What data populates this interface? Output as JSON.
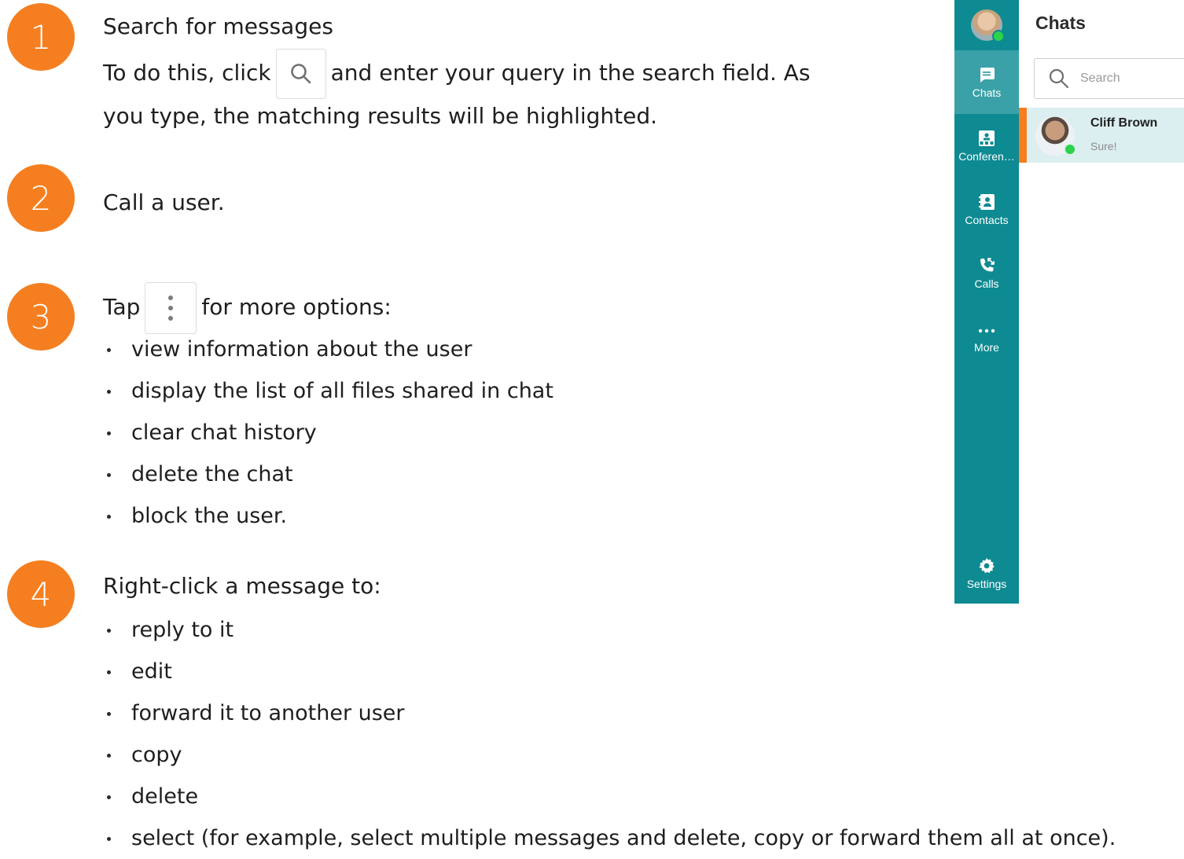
{
  "steps": [
    {
      "number": "1",
      "title": "Search for messages",
      "line2_before": "To do this, click",
      "line2_after": "and enter your query in the search field. As",
      "line3": "you type, the matching results will be highlighted.",
      "inline_icon": "search-icon"
    },
    {
      "number": "2",
      "title": "Call a user."
    },
    {
      "number": "3",
      "title_before": "Tap",
      "title_after": "for more options:",
      "inline_icon": "more-vertical-icon",
      "bullets": [
        "view information about the user",
        "display the list of all files shared in chat",
        "clear chat history",
        "delete the chat",
        "block the user."
      ]
    },
    {
      "number": "4",
      "title": "Right-click a message to:",
      "bullets": [
        "reply to it",
        "edit",
        "forward it to another user",
        "copy",
        "delete",
        "select (for example, select multiple messages and delete, copy or forward them all at once)."
      ]
    }
  ],
  "app": {
    "nav": [
      {
        "label": "Chats",
        "icon": "chat-icon",
        "active": true
      },
      {
        "label": "Conferen…",
        "icon": "conference-icon",
        "active": false
      },
      {
        "label": "Contacts",
        "icon": "contacts-icon",
        "active": false
      },
      {
        "label": "Calls",
        "icon": "calls-icon",
        "active": false
      },
      {
        "label": "More",
        "icon": "more-horizontal-icon",
        "active": false
      }
    ],
    "settings_label": "Settings",
    "list_title": "Chats",
    "search_placeholder": "Search",
    "chats": [
      {
        "name": "Cliff Brown",
        "last_message": "Sure!"
      }
    ]
  },
  "colors": {
    "accent_orange": "#f57f20",
    "rail_teal": "#0e8a92",
    "rail_active": "#3aa1a8",
    "selected_row": "#dceff0",
    "online_green": "#2bd34a"
  }
}
